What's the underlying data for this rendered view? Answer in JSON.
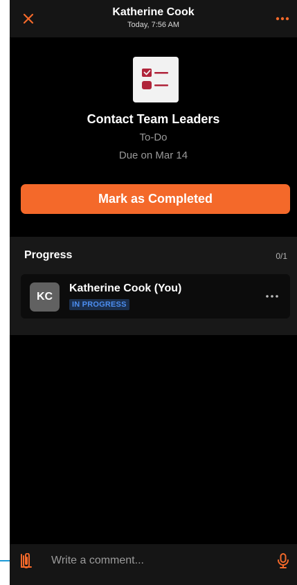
{
  "header": {
    "title": "Katherine Cook",
    "subtitle": "Today, 7:56 AM",
    "close_icon": "close-icon",
    "more_icon": "more-horizontal-icon"
  },
  "task": {
    "icon": "checklist-icon",
    "title": "Contact Team Leaders",
    "type": "To-Do",
    "due": "Due on Mar 14",
    "complete_button": "Mark as Completed"
  },
  "progress": {
    "title": "Progress",
    "count": "0/1",
    "members": [
      {
        "initials": "KC",
        "name": "Katherine Cook (You)",
        "status": "IN PROGRESS"
      }
    ]
  },
  "comment": {
    "placeholder": "Write a comment...",
    "attach_icon": "attachment-icon",
    "mic_icon": "microphone-icon"
  },
  "colors": {
    "accent": "#f4692a",
    "background": "#000000",
    "header_bg": "#151515",
    "status_badge_text": "#4c8ef0",
    "status_badge_bg": "#1b2f4d",
    "icon_red": "#b0243a"
  }
}
